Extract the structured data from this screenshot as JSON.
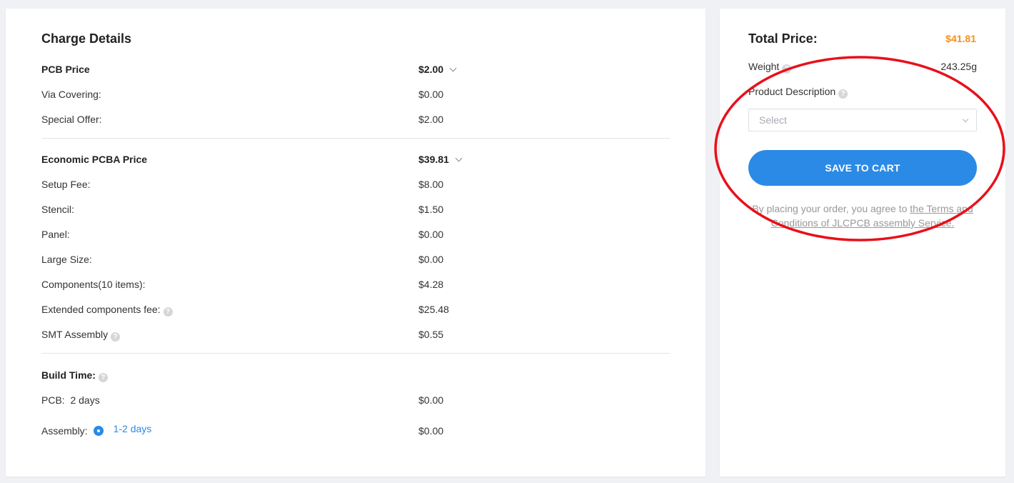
{
  "charge_details": {
    "title": "Charge Details",
    "pcb_price": {
      "label": "PCB Price",
      "value": "$2.00"
    },
    "pcb_items": [
      {
        "label": "Via Covering:",
        "value": "$0.00"
      },
      {
        "label": "Special Offer:",
        "value": "$2.00"
      }
    ],
    "pcba_price": {
      "label": "Economic PCBA Price",
      "value": "$39.81"
    },
    "pcba_items": [
      {
        "label": "Setup Fee:",
        "value": "$8.00"
      },
      {
        "label": "Stencil:",
        "value": "$1.50"
      },
      {
        "label": "Panel:",
        "value": "$0.00"
      },
      {
        "label": "Large Size:",
        "value": "$0.00"
      },
      {
        "label": "Components(10 items):",
        "value": "$4.28"
      },
      {
        "label": "Extended components fee:",
        "value": "$25.48"
      },
      {
        "label": "SMT Assembly",
        "value": "$0.55"
      }
    ],
    "build_time": {
      "label": "Build Time:",
      "pcb_label": "PCB:",
      "pcb_days": "2 days",
      "pcb_value": "$0.00",
      "assembly_label": "Assembly:",
      "assembly_option": "1-2 days",
      "assembly_value": "$0.00"
    }
  },
  "summary": {
    "total_label": "Total Price:",
    "total_value": "$41.81",
    "weight_label": "Weight",
    "weight_value": "243.25g",
    "description_label": "Product Description",
    "select_placeholder": "Select",
    "cart_button": "SAVE TO CART",
    "terms_prefix": "By placing your order, you agree to ",
    "terms_link": "the Terms and Conditions of JLCPCB assembly Service."
  },
  "colors": {
    "accent": "#2b8ae6",
    "price": "#f4901e",
    "annotation": "#e8101a"
  },
  "icons": {
    "help": "question-circle-icon",
    "expand": "chevron-down-icon"
  }
}
